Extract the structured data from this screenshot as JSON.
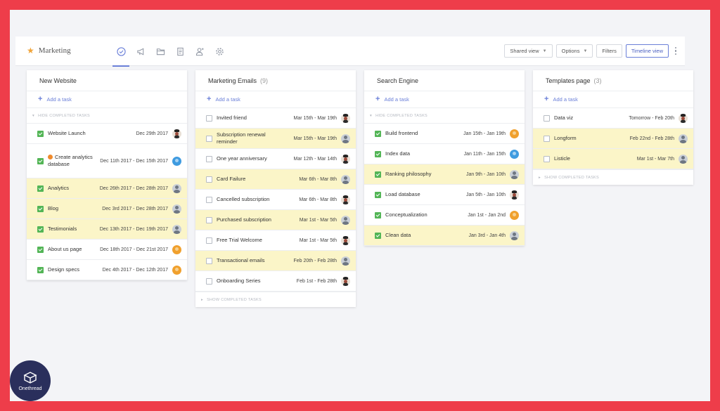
{
  "header": {
    "project_name": "Marketing",
    "shared_view": "Shared view",
    "options": "Options",
    "filters": "Filters",
    "timeline_view": "Timeline view"
  },
  "columns": [
    {
      "title": "New Website",
      "count": "",
      "add_task": "Add a task",
      "completed_toggle": "HIDE COMPLETED TASKS",
      "tasks": [
        {
          "name": "Website Launch",
          "date": "Dec 29th 2017",
          "done": true,
          "hl": false,
          "avatar": "mr"
        },
        {
          "name": "Create analytics database",
          "date": "Dec 11th 2017 - Dec 15th 2017",
          "done": true,
          "hl": false,
          "avatar": "bl",
          "warning": true
        },
        {
          "name": "Analytics",
          "date": "Dec 26th 2017 - Dec 28th 2017",
          "done": true,
          "hl": true,
          "avatar": "gr"
        },
        {
          "name": "Blog",
          "date": "Dec 3rd 2017 - Dec 28th 2017",
          "done": true,
          "hl": true,
          "avatar": "gr"
        },
        {
          "name": "Testimonials",
          "date": "Dec 13th 2017 - Dec 19th 2017",
          "done": true,
          "hl": true,
          "avatar": "gr"
        },
        {
          "name": "About us page",
          "date": "Dec 18th 2017 - Dec 21st 2017",
          "done": true,
          "hl": false,
          "avatar": "or"
        },
        {
          "name": "Design specs",
          "date": "Dec 4th 2017 - Dec 12th 2017",
          "done": true,
          "hl": false,
          "avatar": "or"
        }
      ]
    },
    {
      "title": "Marketing Emails",
      "count": "(9)",
      "add_task": "Add a task",
      "completed_toggle": "SHOW COMPLETED TASKS",
      "tasks": [
        {
          "name": "Invited friend",
          "date": "Mar 15th - Mar 19th",
          "done": false,
          "hl": false,
          "avatar": "mr"
        },
        {
          "name": "Subscription renewal reminder",
          "date": "Mar 15th - Mar 19th",
          "done": false,
          "hl": true,
          "avatar": "gr"
        },
        {
          "name": "One year anniversary",
          "date": "Mar 12th - Mar 14th",
          "done": false,
          "hl": false,
          "avatar": "mr"
        },
        {
          "name": "Card Failure",
          "date": "Mar 6th - Mar 8th",
          "done": false,
          "hl": true,
          "avatar": "gr"
        },
        {
          "name": "Cancelled subscription",
          "date": "Mar 6th - Mar 8th",
          "done": false,
          "hl": false,
          "avatar": "mr"
        },
        {
          "name": "Purchased subscription",
          "date": "Mar 1st - Mar 5th",
          "done": false,
          "hl": true,
          "avatar": "gr"
        },
        {
          "name": "Free Trial Welcome",
          "date": "Mar 1st - Mar 5th",
          "done": false,
          "hl": false,
          "avatar": "mr"
        },
        {
          "name": "Transactional emails",
          "date": "Feb 20th - Feb 28th",
          "done": false,
          "hl": true,
          "avatar": "gr"
        },
        {
          "name": "Onboarding Series",
          "date": "Feb 1st - Feb 28th",
          "done": false,
          "hl": false,
          "avatar": "mr"
        }
      ]
    },
    {
      "title": "Search Engine",
      "count": "",
      "add_task": "Add a task",
      "completed_toggle": "HIDE COMPLETED TASKS",
      "tasks": [
        {
          "name": "Build frontend",
          "date": "Jan 15th - Jan 19th",
          "done": true,
          "hl": false,
          "avatar": "or"
        },
        {
          "name": "Index data",
          "date": "Jan 11th - Jan 15th",
          "done": true,
          "hl": false,
          "avatar": "bl"
        },
        {
          "name": "Ranking philosophy",
          "date": "Jan 9th - Jan 10th",
          "done": true,
          "hl": true,
          "avatar": "gr"
        },
        {
          "name": "Load database",
          "date": "Jan 5th - Jan 10th",
          "done": true,
          "hl": false,
          "avatar": "mr"
        },
        {
          "name": "Conceptualization",
          "date": "Jan 1st - Jan 2nd",
          "done": true,
          "hl": false,
          "avatar": "or"
        },
        {
          "name": "Clean data",
          "date": "Jan 3rd - Jan 4th",
          "done": true,
          "hl": true,
          "avatar": "gr"
        }
      ]
    },
    {
      "title": "Templates page",
      "count": "(3)",
      "add_task": "Add a task",
      "completed_toggle": "SHOW COMPLETED TASKS",
      "tasks": [
        {
          "name": "Data viz",
          "date": "Tomorrow - Feb 20th",
          "done": false,
          "hl": false,
          "avatar": "mr"
        },
        {
          "name": "Longform",
          "date": "Feb 22nd - Feb 28th",
          "done": false,
          "hl": true,
          "avatar": "gr"
        },
        {
          "name": "Listicle",
          "date": "Mar 1st - Mar 7th",
          "done": false,
          "hl": true,
          "avatar": "gr"
        }
      ]
    }
  ],
  "logo": {
    "text": "Onethread"
  },
  "colors": {
    "accent": "#6a7fd8",
    "frame": "#ee3d4a",
    "highlight": "#fbf5c8",
    "done": "#53b556"
  }
}
